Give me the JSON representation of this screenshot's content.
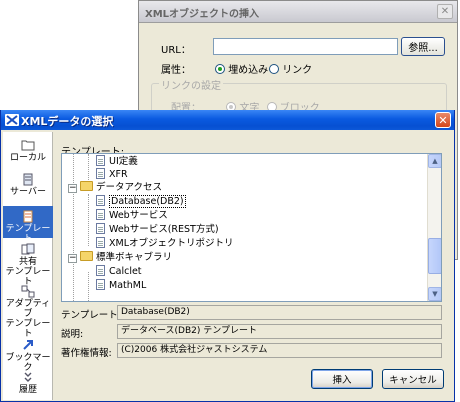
{
  "background_dialog": {
    "title": "XMLオブジェクトの挿入",
    "close_glyph": "✕",
    "url_label": "URL：",
    "url_value": "",
    "browse_button": "参照...",
    "attribute_label": "属性：",
    "embed_option": "埋め込み",
    "link_option": "リンク",
    "link_group_title": "リンクの設定",
    "display_label": "配置：",
    "text_option": "文字",
    "block_option": "ブロック"
  },
  "main_dialog": {
    "title": "XMLデータの選択",
    "close_glyph": "✕",
    "sidebar": [
      {
        "label": "ローカル",
        "icon": "folder-icon",
        "selected": false
      },
      {
        "label": "サーバー",
        "icon": "server-icon",
        "selected": false
      },
      {
        "label": "テンプレート",
        "icon": "template-icon",
        "selected": true
      },
      {
        "label": "共有\nテンプレート",
        "icon": "shared-template-icon",
        "selected": false
      },
      {
        "label": "アダプティブ\nテンプレート",
        "icon": "adaptive-template-icon",
        "selected": false
      },
      {
        "label": "ブックマーク",
        "icon": "bookmark-icon",
        "selected": false
      },
      {
        "label": "履歴",
        "icon": "history-icon",
        "selected": false
      }
    ],
    "template_list_label": "テンプレート:",
    "tree": [
      {
        "label": "UI定義",
        "kind": "doc",
        "level": 2
      },
      {
        "label": "XFR",
        "kind": "doc",
        "level": 2
      },
      {
        "label": "データアクセス",
        "kind": "folder",
        "level": 1,
        "expanded": true
      },
      {
        "label": "Database(DB2)",
        "kind": "doc",
        "level": 2,
        "selected": true
      },
      {
        "label": "Webサービス",
        "kind": "doc",
        "level": 2
      },
      {
        "label": "Webサービス(REST方式)",
        "kind": "doc",
        "level": 2
      },
      {
        "label": "XMLオブジェクトリポジトリ",
        "kind": "doc",
        "level": 2
      },
      {
        "label": "標準ボキャブラリ",
        "kind": "folder",
        "level": 1,
        "expanded": true
      },
      {
        "label": "Calclet",
        "kind": "doc",
        "level": 2
      },
      {
        "label": "MathML",
        "kind": "doc",
        "level": 2
      }
    ],
    "fields": {
      "template_name_label": "テンプレート名:",
      "template_name_value": "Database(DB2)",
      "description_label": "説明:",
      "description_value": "データベース(DB2) テンプレート",
      "copyright_label": "著作権情報:",
      "copyright_value": "(C)2006 株式会社ジャストシステム"
    },
    "buttons": {
      "insert": "挿入",
      "cancel": "キャンセル"
    }
  }
}
